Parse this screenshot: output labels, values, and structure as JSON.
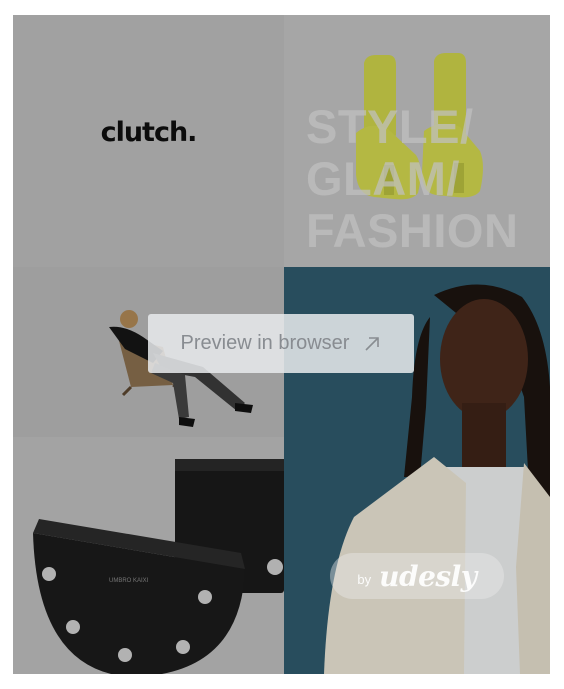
{
  "tiles": {
    "logo_text": "clutch.",
    "style_lines": [
      "STYLE/",
      "GLAM/",
      "FASHION"
    ]
  },
  "bag_label": "UMBRO KAIXI",
  "preview": {
    "label": "Preview in browser",
    "icon": "arrow-up-right-icon"
  },
  "badge": {
    "by": "by",
    "brand": "udesly"
  },
  "colors": {
    "sandal": "#c9cf47",
    "portrait_bg": "#2f5a6d",
    "jacket": "#ece6d6"
  }
}
